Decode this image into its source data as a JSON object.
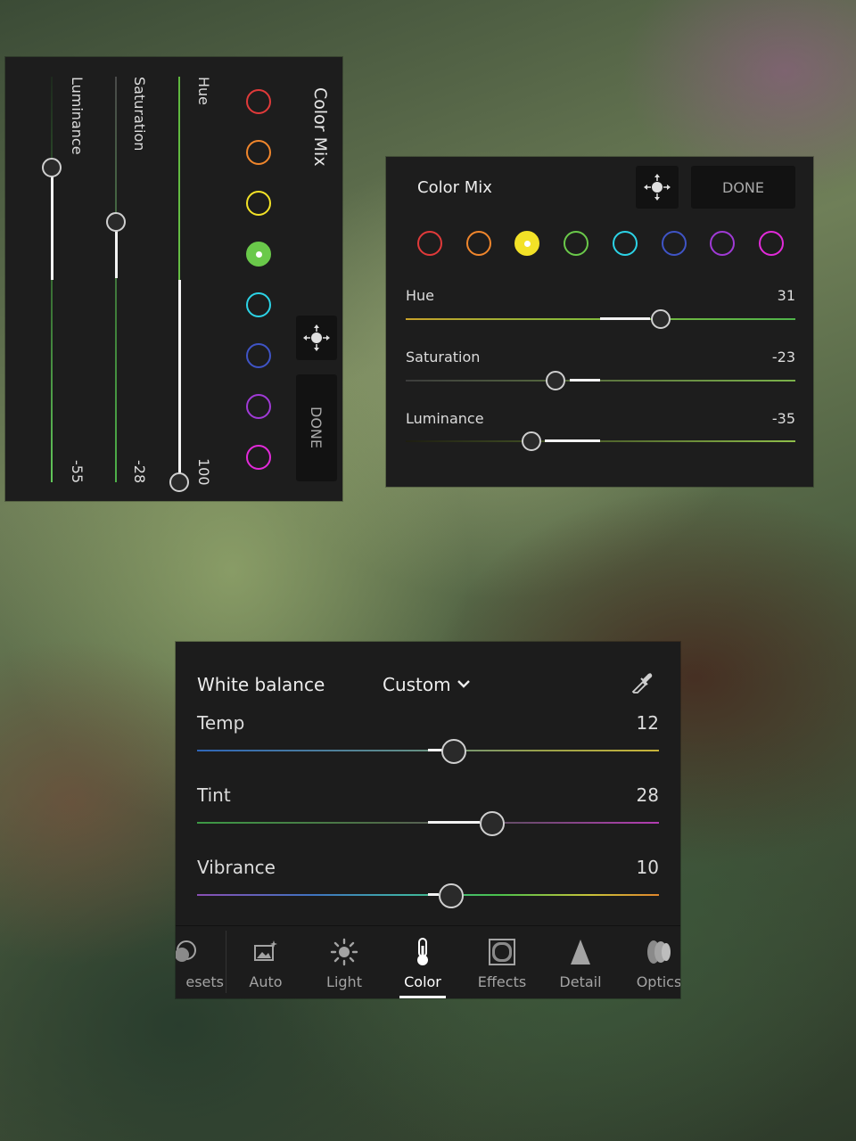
{
  "vertical_panel": {
    "title": "Color Mix",
    "done_label": "DONE",
    "swatches": [
      {
        "name": "red",
        "color": "#e03a3a",
        "selected": false
      },
      {
        "name": "orange",
        "color": "#f0862c",
        "selected": false
      },
      {
        "name": "yellow",
        "color": "#f3e227",
        "selected": false
      },
      {
        "name": "green",
        "color": "#6ac94a",
        "selected": true
      },
      {
        "name": "aqua",
        "color": "#2cd3e6",
        "selected": false
      },
      {
        "name": "blue",
        "color": "#3f54c6",
        "selected": false
      },
      {
        "name": "purple",
        "color": "#a03ad6",
        "selected": false
      },
      {
        "name": "magenta",
        "color": "#e22ad9",
        "selected": false
      }
    ],
    "sliders": [
      {
        "label": "Hue",
        "value": "100"
      },
      {
        "label": "Saturation",
        "value": "-28"
      },
      {
        "label": "Luminance",
        "value": "-55"
      }
    ]
  },
  "horizontal_panel": {
    "title": "Color Mix",
    "done_label": "DONE",
    "swatches": [
      {
        "name": "red",
        "color": "#e03a3a",
        "selected": false
      },
      {
        "name": "orange",
        "color": "#f0862c",
        "selected": false
      },
      {
        "name": "yellow",
        "color": "#f3e227",
        "selected": true
      },
      {
        "name": "green",
        "color": "#6ac94a",
        "selected": false
      },
      {
        "name": "aqua",
        "color": "#2cd3e6",
        "selected": false
      },
      {
        "name": "blue",
        "color": "#3f54c6",
        "selected": false
      },
      {
        "name": "purple",
        "color": "#a03ad6",
        "selected": false
      },
      {
        "name": "magenta",
        "color": "#e22ad9",
        "selected": false
      }
    ],
    "sliders": [
      {
        "label": "Hue",
        "value": "31"
      },
      {
        "label": "Saturation",
        "value": "-23"
      },
      {
        "label": "Luminance",
        "value": "-35"
      }
    ]
  },
  "white_balance_panel": {
    "title": "White balance",
    "preset": "Custom",
    "sliders": [
      {
        "label": "Temp",
        "value": "12"
      },
      {
        "label": "Tint",
        "value": "28"
      },
      {
        "label": "Vibrance",
        "value": "10"
      }
    ]
  },
  "toolbar": {
    "active_tab": "Color",
    "tabs": [
      {
        "label": "Presets",
        "visible_text": "esets",
        "icon": "presets-icon"
      },
      {
        "label": "Auto",
        "icon": "auto-icon"
      },
      {
        "label": "Light",
        "icon": "sun-icon"
      },
      {
        "label": "Color",
        "icon": "thermometer-icon"
      },
      {
        "label": "Effects",
        "icon": "effects-icon"
      },
      {
        "label": "Detail",
        "icon": "detail-icon"
      },
      {
        "label": "Optics",
        "icon": "optics-icon"
      }
    ]
  },
  "colors": {
    "panel_bg": "#1d1d1d",
    "button_bg": "#121212",
    "accent_white": "#f2f2f2"
  }
}
